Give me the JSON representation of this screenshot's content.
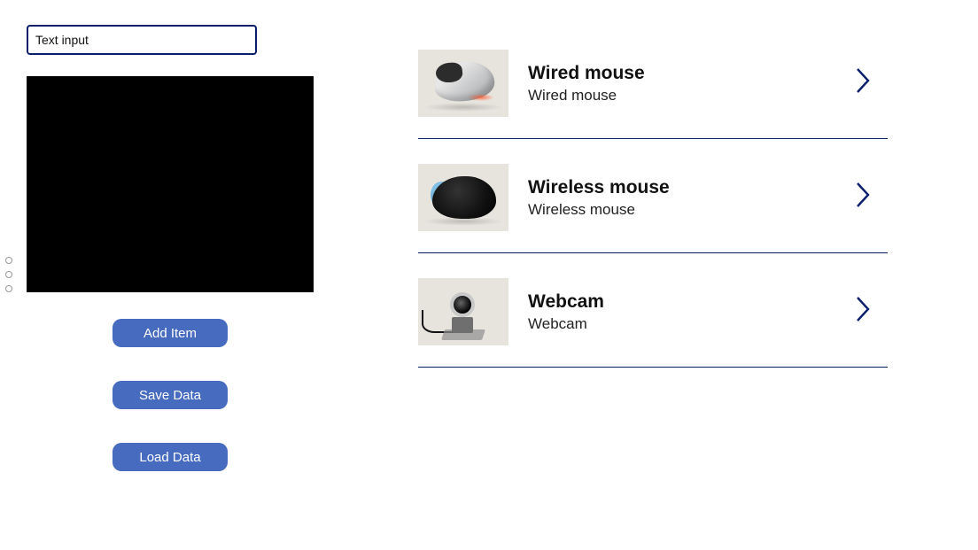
{
  "left": {
    "text_input_placeholder": "Text input",
    "text_input_value": "Text input",
    "buttons": {
      "add_item": "Add Item",
      "save_data": "Save Data",
      "load_data": "Load Data"
    }
  },
  "list": {
    "items": [
      {
        "title": "Wired mouse",
        "subtitle": "Wired mouse",
        "icon": "wired-mouse"
      },
      {
        "title": "Wireless mouse",
        "subtitle": "Wireless mouse",
        "icon": "wireless-mouse"
      },
      {
        "title": "Webcam",
        "subtitle": "Webcam",
        "icon": "webcam"
      }
    ]
  },
  "colors": {
    "accent": "#0a1f6b",
    "button": "#466bbf"
  }
}
